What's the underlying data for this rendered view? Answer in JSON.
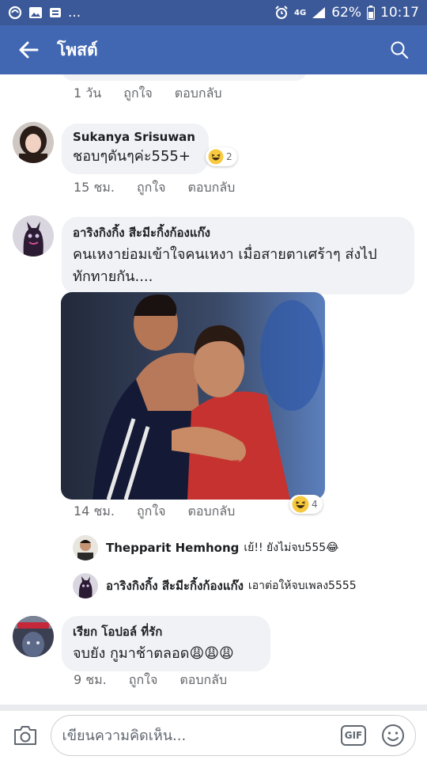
{
  "status_bar": {
    "dots": "...",
    "network": "4G",
    "battery": "62%",
    "time": "10:17"
  },
  "app_bar": {
    "title": "โพสต์"
  },
  "comments": [
    {
      "time": "1 วัน",
      "like": "ถูกใจ",
      "reply": "ตอบกลับ"
    },
    {
      "name": "Sukanya Srisuwan",
      "text": "ชอบๆดันๆค่ะ555+",
      "reaction_count": "2",
      "time": "15 ชม.",
      "like": "ถูกใจ",
      "reply": "ตอบกลับ"
    },
    {
      "name": "อาริงกิงกิ้ง สีะมีะกิ้งก้องแก๊ง",
      "text": "คนเหงาย่อมเข้าใจคนเหงา เมื่อสายตาเศร้าๆ ส่งไปทักทายกัน....",
      "reaction_count": "4",
      "time": "14 ชม.",
      "like": "ถูกใจ",
      "reply": "ตอบกลับ",
      "replies": [
        {
          "name": "Thepparit Hemhong",
          "text": "เย้!! ยังไม่จบ555😂"
        },
        {
          "name": "อาริงกิงกิ้ง สีะมีะกิ้งก้องแก๊ง",
          "text": "เอาต่อให้จบเพลง5555"
        }
      ]
    },
    {
      "name": "เรียก โอปอล์ ที่รัก",
      "text": "จบยัง กูมาช้าตลอด😩😩😩",
      "time": "9 ชม.",
      "like": "ถูกใจ",
      "reply": "ตอบกลับ"
    }
  ],
  "composer": {
    "placeholder": "เขียนความคิดเห็น...",
    "gif_label": "GIF"
  },
  "colors": {
    "status_bar": "#3b5998",
    "app_bar": "#4267b2",
    "bubble": "#f0f2f5",
    "meta_text": "#65676b"
  }
}
